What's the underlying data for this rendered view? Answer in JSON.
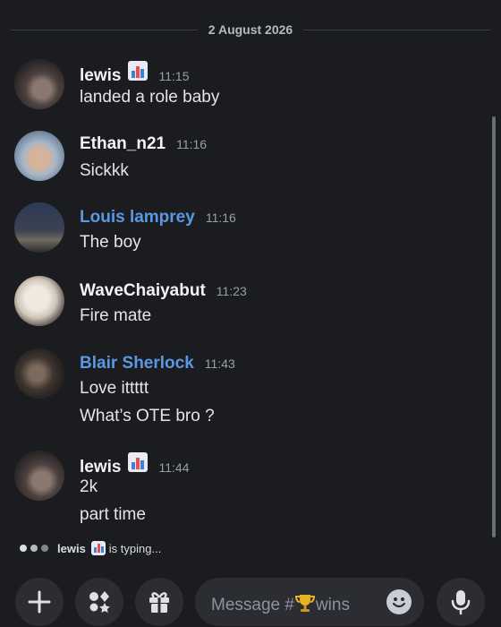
{
  "date_divider": "2 August 2026",
  "messages": [
    {
      "user": "lewis",
      "time": "11:15",
      "lines": [
        "landed a role baby"
      ]
    },
    {
      "user": "Ethan_n21",
      "time": "11:16",
      "lines": [
        "Sickkk"
      ]
    },
    {
      "user": "Louis lamprey",
      "time": "11:16",
      "lines": [
        "The boy"
      ]
    },
    {
      "user": "WaveChaiyabut",
      "time": "11:23",
      "lines": [
        "Fire mate"
      ]
    },
    {
      "user": "Blair Sherlock",
      "time": "11:43",
      "lines": [
        "Love ittttt",
        "What’s OTE bro ?"
      ]
    },
    {
      "user": "lewis",
      "time": "11:44",
      "lines": [
        "2k",
        "part time"
      ]
    }
  ],
  "typing": {
    "user": "lewis",
    "suffix": "is typing..."
  },
  "composer": {
    "placeholder_prefix": "Message #",
    "channel": "wins"
  },
  "colors": {
    "background": "#1b1c20",
    "link_name": "#5a98e3",
    "surface": "#2b2d33"
  },
  "icons": [
    "chart-emoji-icon",
    "plus-icon",
    "apps-icon",
    "gift-icon",
    "trophy-icon",
    "emoji-icon",
    "microphone-icon"
  ]
}
